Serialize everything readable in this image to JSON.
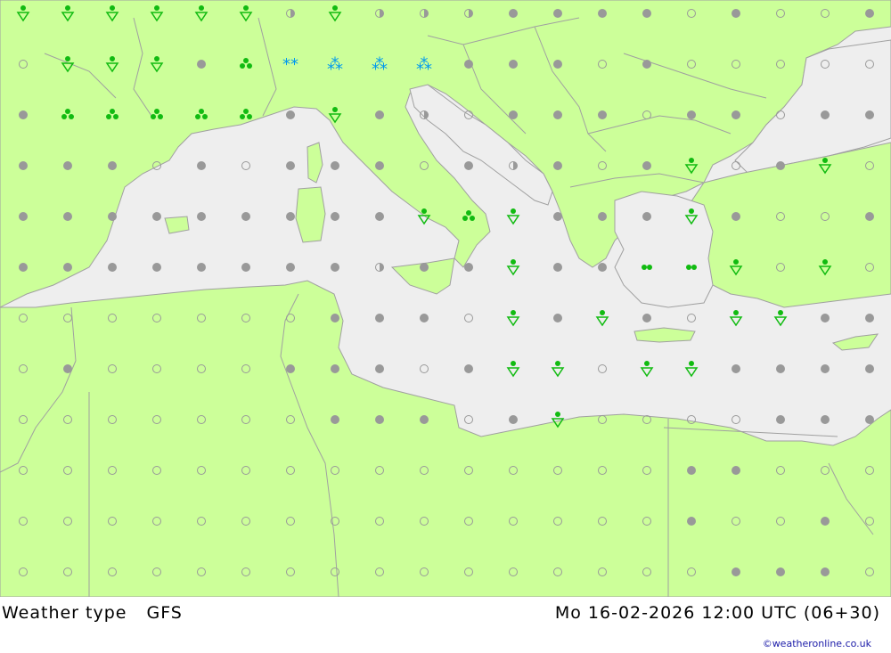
{
  "footer": {
    "product": "Weather type",
    "model": "GFS",
    "valid_time": "Mo 16-02-2026 12:00 UTC (06+30)",
    "credit": "©weatheronline.co.uk"
  },
  "colors": {
    "land": "#ccff99",
    "sea": "#eeeeee",
    "border": "#a0a0a0",
    "cloud_symbol": "#999999",
    "rain_symbol": "#11bb11",
    "snow_symbol": "#0099ee"
  },
  "grid": {
    "columns": 20,
    "rows": 12,
    "symbol_rows": [
      "RRRRRRCRCCCcccc2c22c",
      "2RRRcrPSSSccc2c22222",
      "crrrrrcRcC2ccc2cc2cc",
      "ccc2c2ccc2cCc2cR2cR2",
      "cccccccccRrRcccRc22c",
      "ccccccccCccRcciiR2R2",
      "2222222ccc2RcRc2RRcc",
      "2c2222ccc2cRR2RRcccc",
      "2222222ccc2cR2222ccc",
      "222222222222222cc222",
      "222222222222222c22c2",
      "2222222222222222ccc2"
    ],
    "legend": {
      "c": "cloudy",
      "2": "partly-cloudy",
      "C": "half-cloudy",
      "r": "light-rain",
      "R": "rain-shower",
      "S": "snow",
      "P": "snow-shower",
      "i": "drizzle"
    }
  }
}
